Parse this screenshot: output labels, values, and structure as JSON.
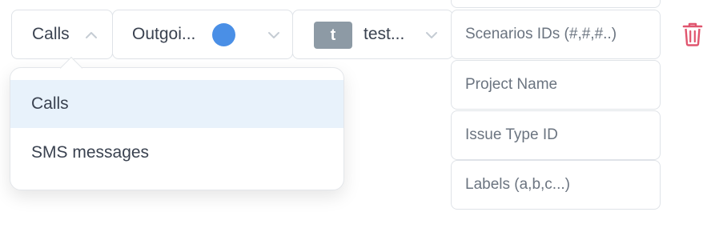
{
  "type_select": {
    "value": "Calls"
  },
  "direction_select": {
    "value": "Outgoi...",
    "status_color": "#4a8fe6"
  },
  "user_select": {
    "avatar_letter": "t",
    "value": "test..."
  },
  "fields": {
    "scenarios_placeholder": "Scenarios IDs (#,#,#..)",
    "project_placeholder": "Project Name",
    "issue_type_placeholder": "Issue Type ID",
    "labels_placeholder": "Labels (a,b,c...)"
  },
  "type_dropdown": {
    "options": [
      {
        "label": "Calls",
        "selected": true
      },
      {
        "label": "SMS messages",
        "selected": false
      }
    ]
  },
  "icons": {
    "delete": "trash-icon",
    "chevron_up": "chevron-up-icon",
    "chevron_down": "chevron-down-icon"
  },
  "colors": {
    "accent": "#4a8fe6",
    "delete": "#e0556e",
    "selected_bg": "#e8f2fb"
  }
}
